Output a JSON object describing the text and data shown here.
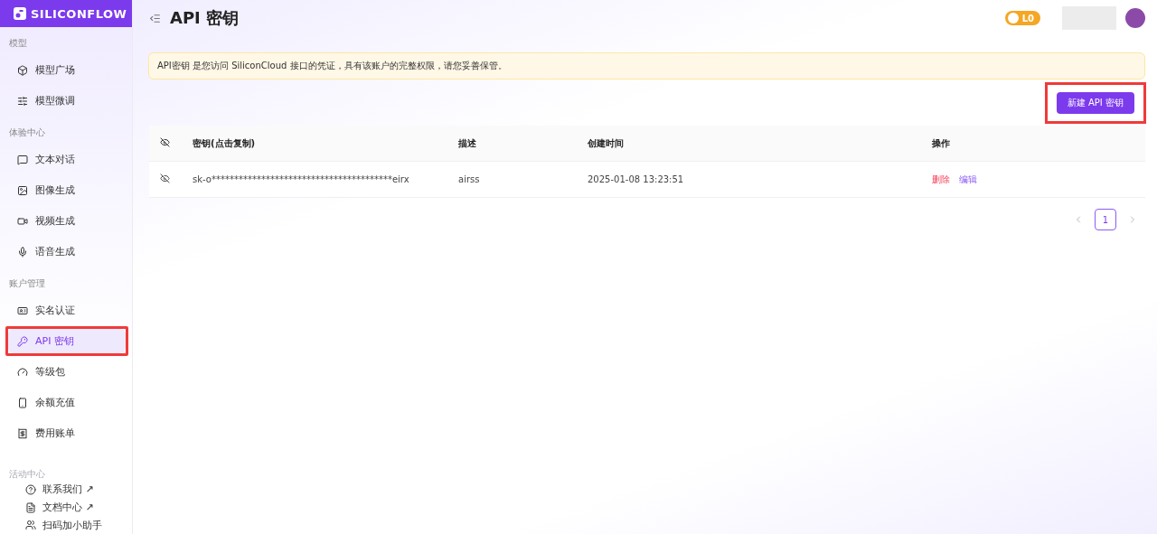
{
  "brand": {
    "name": "SILICONFLOW"
  },
  "sidebar": {
    "sections": [
      {
        "title": "模型",
        "items": [
          {
            "label": "模型广场",
            "selected": false,
            "highlighted": false
          },
          {
            "label": "模型微调",
            "selected": false,
            "highlighted": false
          }
        ]
      },
      {
        "title": "体验中心",
        "items": [
          {
            "label": "文本对话",
            "selected": false,
            "highlighted": false
          },
          {
            "label": "图像生成",
            "selected": false,
            "highlighted": false
          },
          {
            "label": "视频生成",
            "selected": false,
            "highlighted": false
          },
          {
            "label": "语音生成",
            "selected": false,
            "highlighted": false
          }
        ]
      },
      {
        "title": "账户管理",
        "items": [
          {
            "label": "实名认证",
            "selected": false,
            "highlighted": false
          },
          {
            "label": "API 密钥",
            "selected": true,
            "highlighted": true
          },
          {
            "label": "等级包",
            "selected": false,
            "highlighted": false
          },
          {
            "label": "余额充值",
            "selected": false,
            "highlighted": false
          },
          {
            "label": "费用账单",
            "selected": false,
            "highlighted": false
          }
        ]
      }
    ],
    "footer_title": "活动中心",
    "footer_links": [
      {
        "label": "联系我们",
        "arrow": "↗"
      },
      {
        "label": "文档中心",
        "arrow": "↗"
      },
      {
        "label": "扫码加小助手"
      }
    ]
  },
  "header": {
    "title": "API 密钥",
    "level_badge": "L0"
  },
  "alert": {
    "text": "API密钥 是您访问 SiliconCloud 接口的凭证，具有该账户的完整权限，请您妥善保管。"
  },
  "new_button": {
    "label": "新建 API 密钥",
    "highlighted": true
  },
  "table": {
    "columns": [
      "密钥(点击复制)",
      "描述",
      "创建时间",
      "操作"
    ],
    "rows": [
      {
        "key": "sk-o****************************************eirx",
        "description": "airss",
        "created": "2025-01-08 13:23:51",
        "actions": [
          {
            "label": "删除",
            "kind": "danger"
          },
          {
            "label": "编辑",
            "kind": "primary"
          }
        ]
      }
    ]
  },
  "pagination": {
    "pages": [
      {
        "label": "1",
        "selected": true
      }
    ]
  }
}
